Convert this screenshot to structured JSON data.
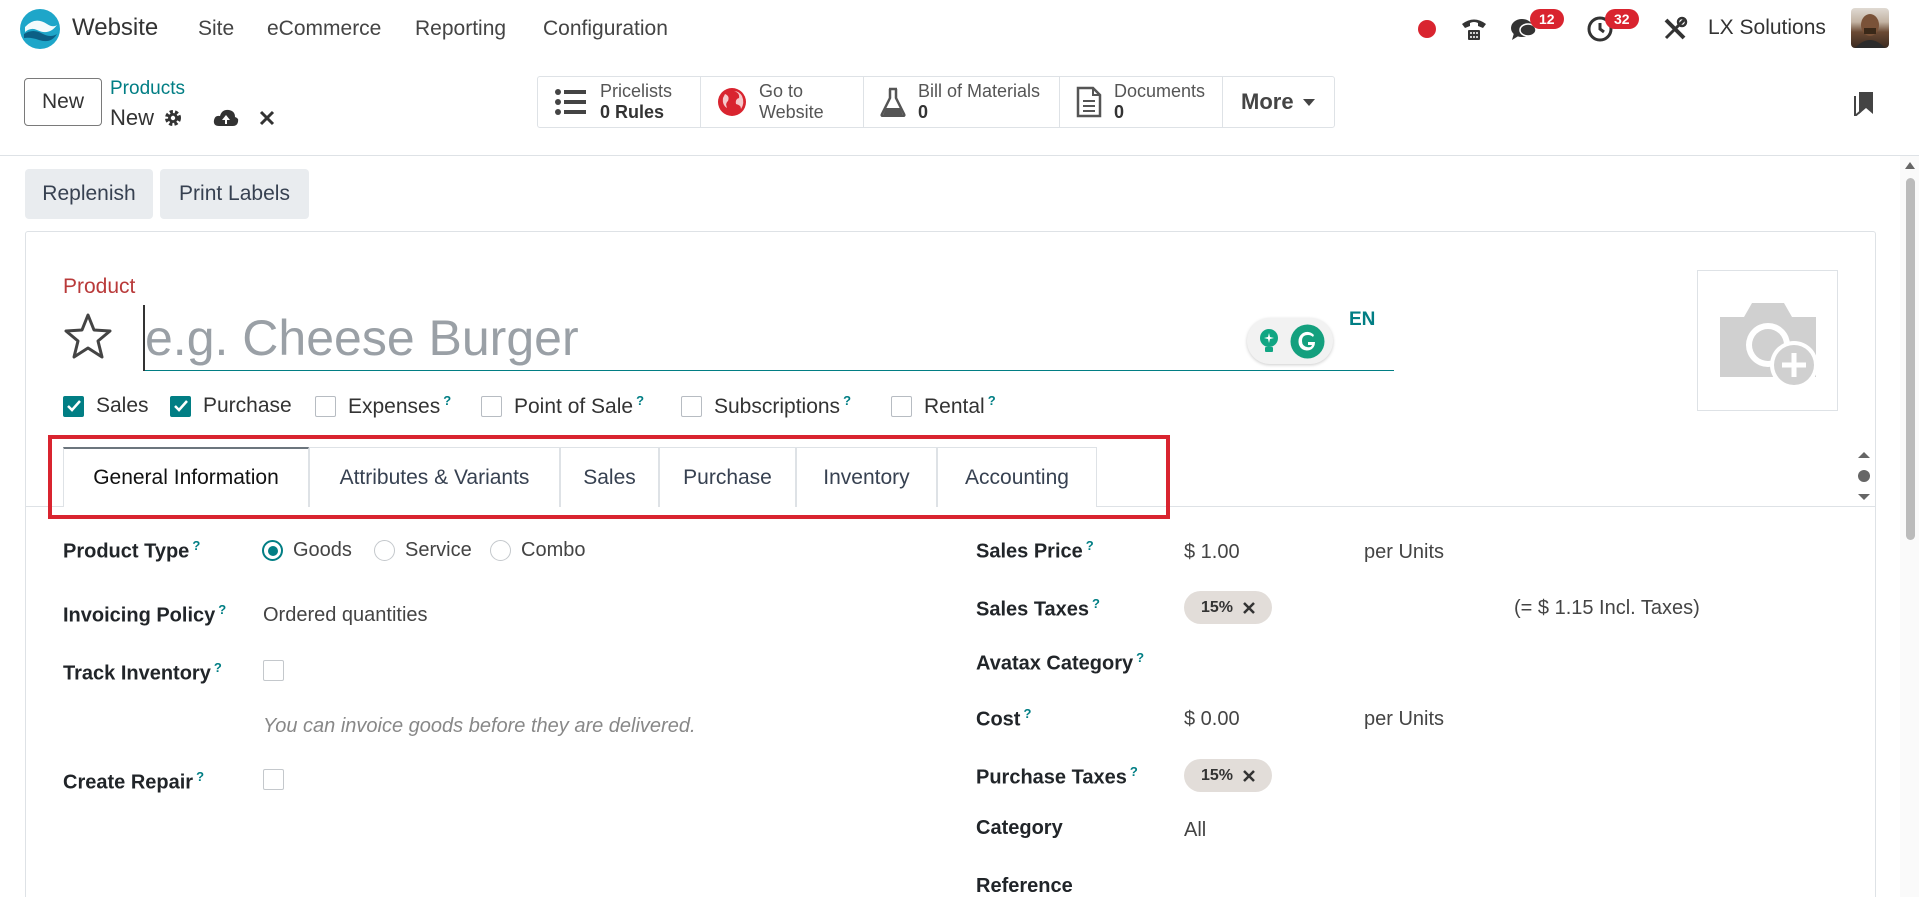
{
  "topnav": {
    "app_name": "Website",
    "menus": [
      "Site",
      "eCommerce",
      "Reporting",
      "Configuration"
    ],
    "chat_badge": "12",
    "activity_badge": "32",
    "company": "LX Solutions",
    "icons": [
      "recording-dot-icon",
      "phone-icon",
      "chat-icon",
      "clock-icon",
      "tools-icon"
    ]
  },
  "control": {
    "new_label": "New",
    "breadcrumb_parent": "Products",
    "breadcrumb_current": "New",
    "smart_buttons": [
      {
        "label": "Pricelists",
        "value": "0 Rules",
        "icon": "list-icon"
      },
      {
        "label": "Go to",
        "value": "Website",
        "icon": "globe-icon"
      },
      {
        "label": "Bill of Materials",
        "value": "0",
        "icon": "flask-icon"
      },
      {
        "label": "Documents",
        "value": "0",
        "icon": "document-icon"
      }
    ],
    "more_label": "More"
  },
  "actions": {
    "replenish": "Replenish",
    "print_labels": "Print Labels"
  },
  "form": {
    "product_label": "Product",
    "name_placeholder": "e.g. Cheese Burger",
    "lang": "EN",
    "checkboxes": [
      {
        "label": "Sales",
        "checked": true,
        "help": false
      },
      {
        "label": "Purchase",
        "checked": true,
        "help": false
      },
      {
        "label": "Expenses",
        "checked": false,
        "help": true
      },
      {
        "label": "Point of Sale",
        "checked": false,
        "help": true
      },
      {
        "label": "Subscriptions",
        "checked": false,
        "help": true
      },
      {
        "label": "Rental",
        "checked": false,
        "help": true
      }
    ],
    "tabs": [
      "General Information",
      "Attributes & Variants",
      "Sales",
      "Purchase",
      "Inventory",
      "Accounting"
    ],
    "active_tab": "General Information",
    "left": {
      "product_type_label": "Product Type",
      "product_type_options": [
        "Goods",
        "Service",
        "Combo"
      ],
      "product_type_selected": "Goods",
      "invoicing_policy_label": "Invoicing Policy",
      "invoicing_policy_value": "Ordered quantities",
      "track_inventory_label": "Track Inventory",
      "help_text": "You can invoice goods before they are delivered.",
      "create_repair_label": "Create Repair"
    },
    "right": {
      "sales_price_label": "Sales Price",
      "sales_price_value": "$ 1.00",
      "sales_price_unit": "per Units",
      "sales_taxes_label": "Sales Taxes",
      "sales_tax_tag": "15%",
      "sales_tax_incl": "(= $ 1.15 Incl. Taxes)",
      "avatax_label": "Avatax Category",
      "cost_label": "Cost",
      "cost_value": "$ 0.00",
      "cost_unit": "per Units",
      "purchase_taxes_label": "Purchase Taxes",
      "purchase_tax_tag": "15%",
      "category_label": "Category",
      "category_value": "All",
      "reference_label": "Reference"
    }
  },
  "colors": {
    "brand": "#017e84",
    "badge": "#d9242f",
    "highlight": "#d9242f",
    "product_label": "#b93a3a"
  }
}
